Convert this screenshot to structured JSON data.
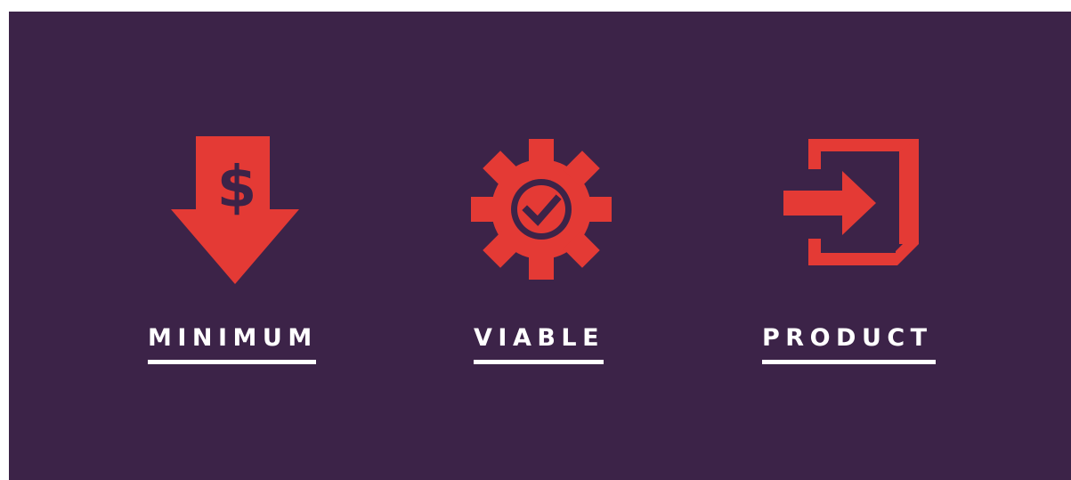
{
  "accent_color": "#e43a35",
  "background_color": "#3c2348",
  "text_color": "#ffffff",
  "items": [
    {
      "label": "MINIMUM",
      "icon": "dollar-down-arrow-icon"
    },
    {
      "label": "VIABLE",
      "icon": "gear-check-icon"
    },
    {
      "label": "PRODUCT",
      "icon": "box-enter-arrow-icon"
    }
  ]
}
